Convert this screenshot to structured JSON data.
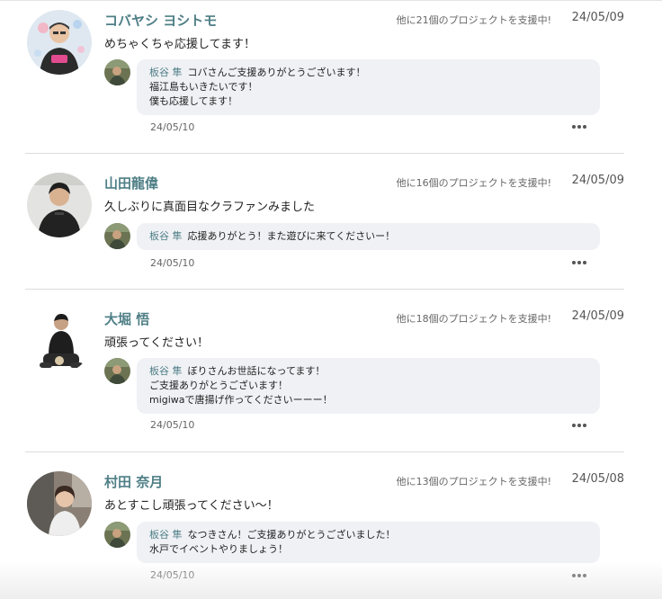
{
  "comments": [
    {
      "author": "コバヤシ ヨシトモ",
      "support_note": "他に21個のプロジェクトを支援中!",
      "date": "24/05/09",
      "text": "めちゃくちゃ応援してます！",
      "avatar_icon": "user-avatar-photo",
      "reply": {
        "author": "板谷 隼",
        "first_line": "コバさんご支援ありがとうございます！",
        "more_lines": [
          "福江島もいきたいです！",
          "僕も応援してます！"
        ],
        "date": "24/05/10",
        "avatar_icon": "owner-avatar-photo"
      }
    },
    {
      "author": "山田龍偉",
      "support_note": "他に16個のプロジェクトを支援中!",
      "date": "24/05/09",
      "text": "久しぶりに真面目なクラファンみました",
      "avatar_icon": "user-avatar-photo",
      "reply": {
        "author": "板谷 隼",
        "first_line": "応援ありがとう！また遊びに来てくださいー！",
        "more_lines": [],
        "date": "24/05/10",
        "avatar_icon": "owner-avatar-photo"
      }
    },
    {
      "author": "大堀 悟",
      "support_note": "他に18個のプロジェクトを支援中!",
      "date": "24/05/09",
      "text": "頑張ってください！",
      "avatar_icon": "user-avatar-photo",
      "reply": {
        "author": "板谷 隼",
        "first_line": "ぼりさんお世話になってます！",
        "more_lines": [
          "ご支援ありがとうございます！",
          "migiwaで唐揚げ作ってくださいーーー！"
        ],
        "date": "24/05/10",
        "avatar_icon": "owner-avatar-photo"
      }
    },
    {
      "author": "村田 奈月",
      "support_note": "他に13個のプロジェクトを支援中!",
      "date": "24/05/08",
      "text": "あとすこし頑張ってください〜！",
      "avatar_icon": "user-avatar-photo",
      "reply": {
        "author": "板谷 隼",
        "first_line": "なつきさん！ご支援ありがとうございました！",
        "more_lines": [
          "水戸でイベントやりましょう！"
        ],
        "date": "24/05/10",
        "avatar_icon": "owner-avatar-photo"
      }
    }
  ],
  "colors": {
    "name_accent": "#4f7f86",
    "bubble_background": "#eff1f5",
    "divider": "#dddddd"
  },
  "icons": {
    "more_menu": "more-horizontal-icon"
  }
}
